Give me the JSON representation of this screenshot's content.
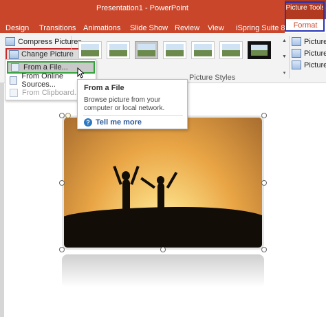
{
  "window": {
    "title": "Presentation1  -  PowerPoint"
  },
  "tabs": [
    "Design",
    "Transitions",
    "Animations",
    "Slide Show",
    "Review",
    "View",
    "iSpring Suite 8"
  ],
  "context_tab_group": {
    "label": "Picture Tools",
    "active_tab": "Format"
  },
  "ribbon": {
    "compress_label": "Compress Pictures",
    "change_picture_label": "Change Picture",
    "picture_styles_label": "Picture Styles",
    "right_commands": [
      "Picture B",
      "Picture E",
      "Picture L"
    ]
  },
  "dropdown": {
    "items": [
      {
        "label": "From a File...",
        "state": "hover"
      },
      {
        "label": "From Online Sources...",
        "state": "normal"
      },
      {
        "label": "From Clipboard...",
        "state": "disabled"
      }
    ]
  },
  "tooltip": {
    "title": "From a File",
    "description": "Browse picture from your computer or local network.",
    "help": "Tell me more"
  },
  "colors": {
    "ribbon_accent": "#c9462b",
    "hover_outline": "#33a23b",
    "change_outline": "#c62a2a",
    "context_outline": "#2733b8"
  }
}
